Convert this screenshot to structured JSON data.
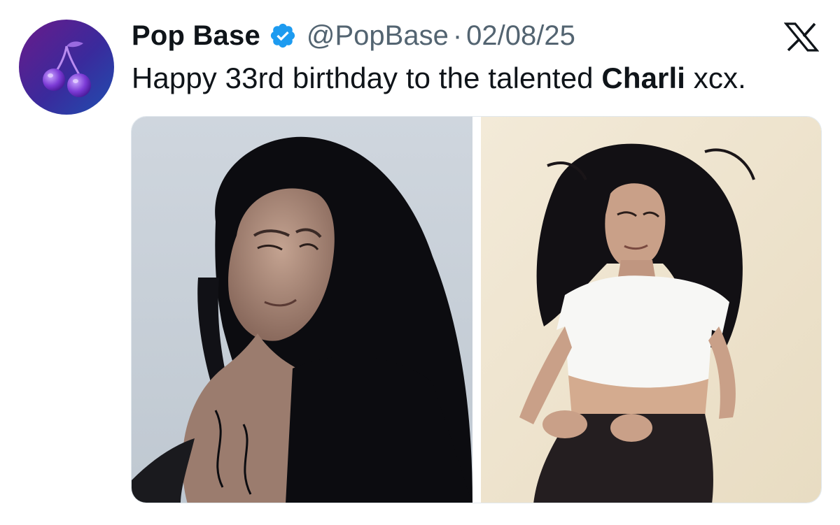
{
  "tweet": {
    "author": {
      "display_name": "Pop Base",
      "handle": "@PopBase",
      "verified": true,
      "avatar_icon": "cherry-icon"
    },
    "separator": "·",
    "date": "02/08/25",
    "text_before": "Happy 33rd birthday to the talented ",
    "text_bold": "Charli",
    "text_after": " xcx.",
    "media_count": 2,
    "platform_icon": "x-logo-icon"
  },
  "colors": {
    "name": "#0f1419",
    "secondary": "#536471",
    "verified": "#1d9bf0",
    "avatar_bg_start": "#5b1e8c",
    "avatar_bg_end": "#1f3a9a"
  }
}
